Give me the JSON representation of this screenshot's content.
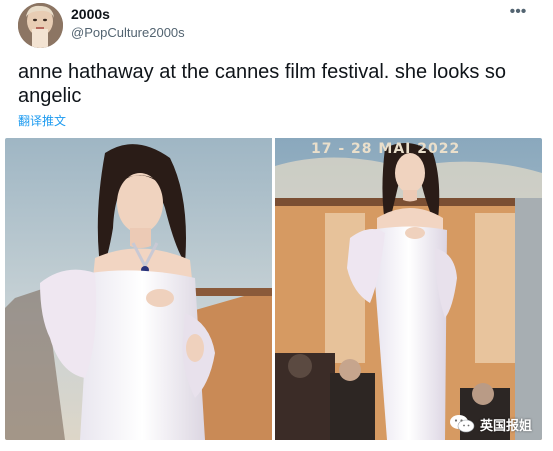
{
  "tweet": {
    "display_name": "2000s",
    "handle": "@PopCulture2000s",
    "text": "anne hathaway at the cannes film festival. she looks so angelic",
    "translate_label": "翻译推文",
    "more_icon": "more-horizontal-icon"
  },
  "media": {
    "right_banner": "17 - 28 MAI 2022"
  },
  "watermark": {
    "label": "英国报姐",
    "icon": "wechat-icon"
  },
  "colors": {
    "link": "#1d9bf0",
    "text": "#0f1419",
    "secondary": "#536471"
  }
}
